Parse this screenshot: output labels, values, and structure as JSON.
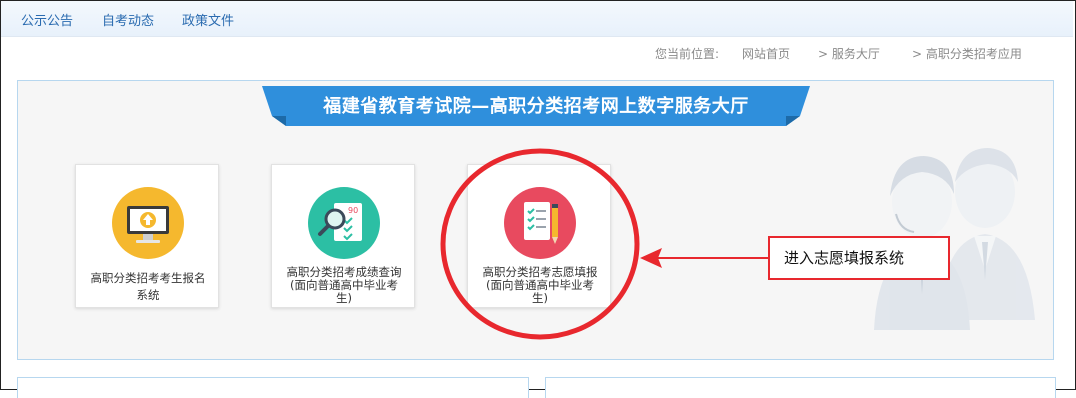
{
  "nav": {
    "items": [
      "公示公告",
      "自考动态",
      "政策文件"
    ]
  },
  "breadcrumb": {
    "prefix": "您当前位置:",
    "items": [
      "网站首页",
      "> 服务大厅",
      "> 高职分类招考应用"
    ]
  },
  "banner": {
    "title": "福建省教育考试院—高职分类招考网上数字服务大厅"
  },
  "cards": [
    {
      "label_lines": [
        "高职分类招考考生报名",
        "系统"
      ],
      "icon": "monitor-upload-icon",
      "color": "#f5b82e"
    },
    {
      "label_lines": [
        "高职分类招考成绩查询",
        "(面向普通高中毕业考",
        "生)"
      ],
      "icon": "score-search-icon",
      "color": "#2cbfa4"
    },
    {
      "label_lines": [
        "高职分类招考志愿填报",
        "(面向普通高中毕业考",
        "生)"
      ],
      "icon": "checklist-pencil-icon",
      "color": "#e84a5f"
    }
  ],
  "annotation": {
    "text": "进入志愿填报系统",
    "color": "#e8282e"
  },
  "colors": {
    "banner": "#2f8fdc",
    "panel_border": "#b7d7ef",
    "nav_text": "#2a6bb0"
  }
}
